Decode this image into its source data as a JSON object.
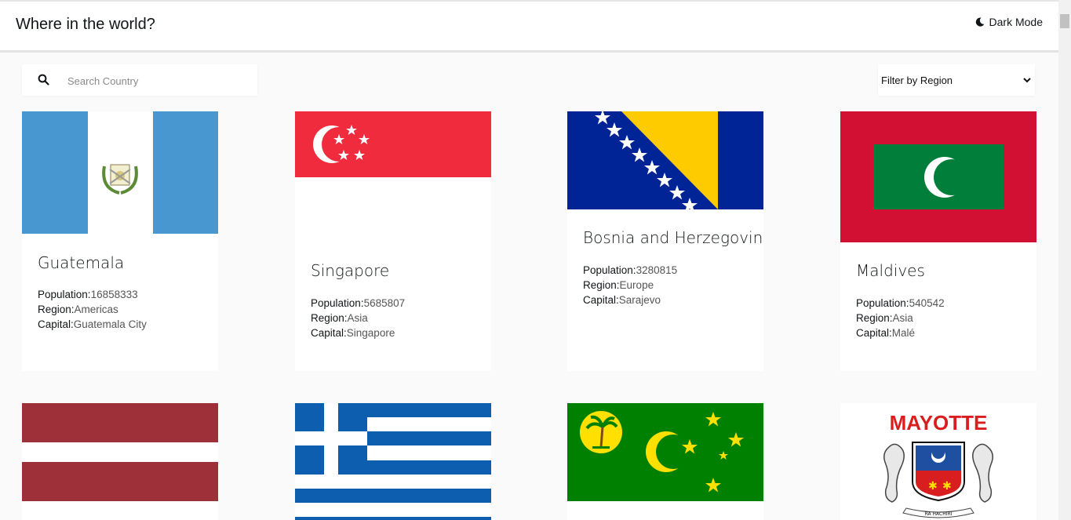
{
  "header": {
    "title": "Where in the world?",
    "dark_mode_label": "Dark Mode"
  },
  "search": {
    "placeholder": "Search Country"
  },
  "filter": {
    "label": "Filter by Region"
  },
  "field_labels": {
    "population": "Population:",
    "region": "Region:",
    "capital": "Capital:"
  },
  "countries": [
    {
      "name": "Guatemala",
      "population": "16858333",
      "region": "Americas",
      "capital": "Guatemala City"
    },
    {
      "name": "Singapore",
      "population": "5685807",
      "region": "Asia",
      "capital": "Singapore"
    },
    {
      "name": "Bosnia and Herzegovina",
      "population": "3280815",
      "region": "Europe",
      "capital": "Sarajevo"
    },
    {
      "name": "Maldives",
      "population": "540542",
      "region": "Asia",
      "capital": "Malé"
    },
    {
      "name": "",
      "population": "",
      "region": "",
      "capital": ""
    },
    {
      "name": "",
      "population": "",
      "region": "",
      "capital": ""
    },
    {
      "name": "",
      "population": "",
      "region": "",
      "capital": ""
    },
    {
      "name": "",
      "population": "",
      "region": "",
      "capital": ""
    }
  ],
  "flag_texts": {
    "mayotte_title": "MAYOTTE",
    "mayotte_motto": "RA HACHIRI"
  },
  "colors": {
    "background": "#fafafa",
    "card": "#ffffff",
    "text": "#111517"
  }
}
